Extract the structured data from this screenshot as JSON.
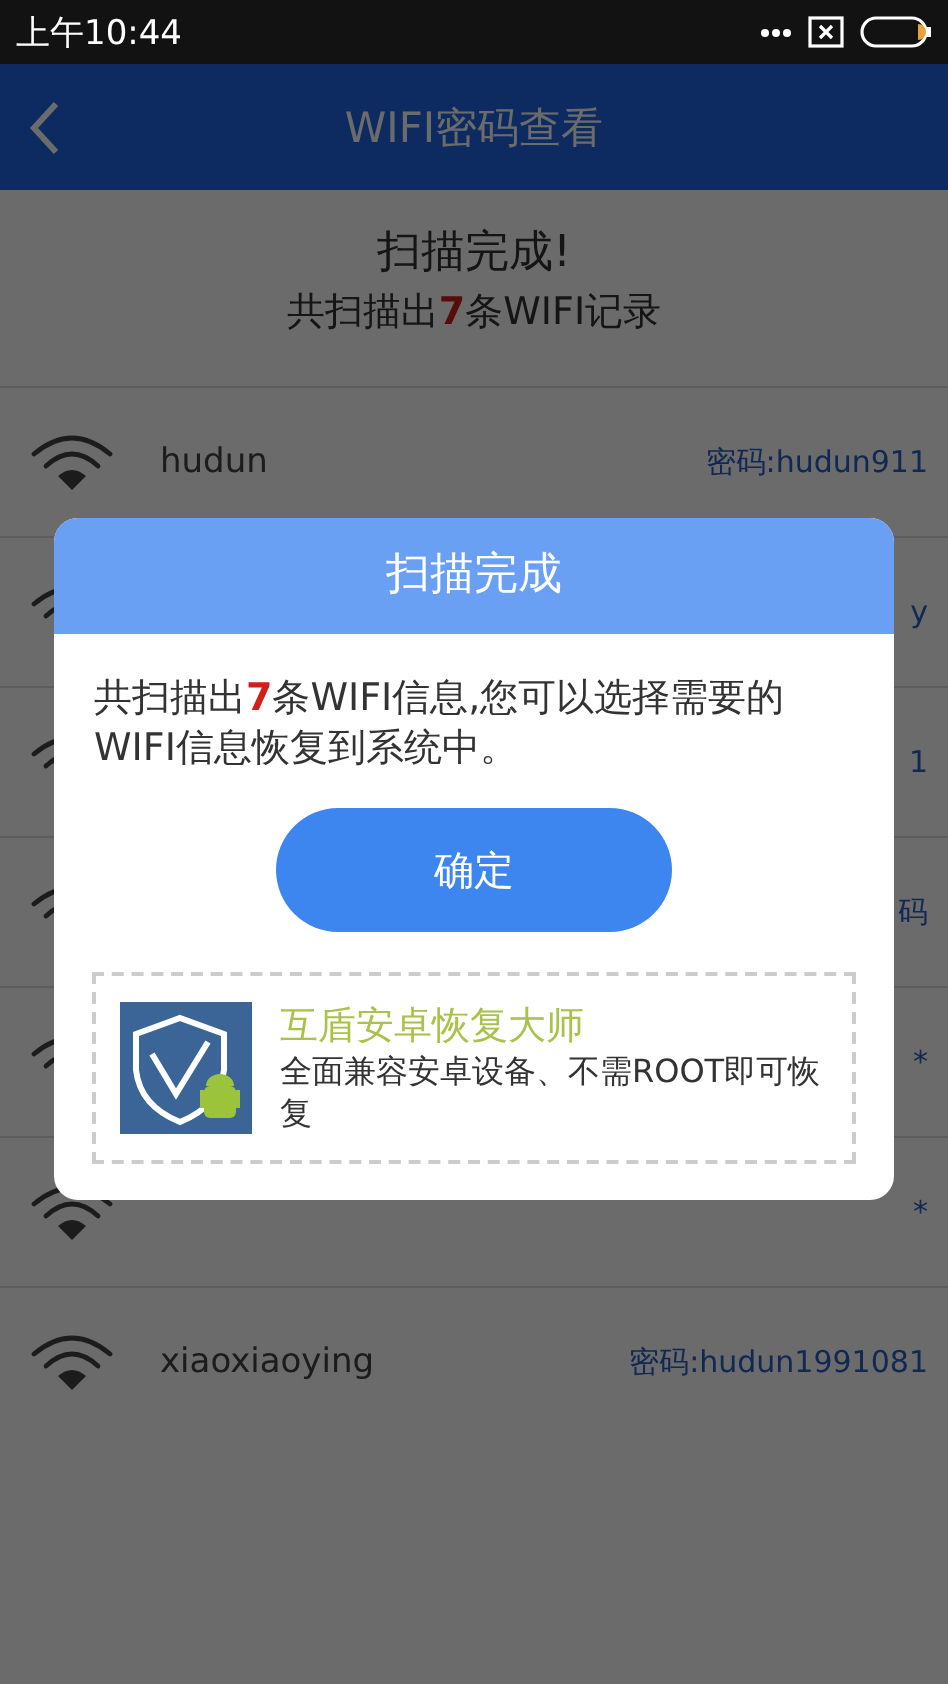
{
  "status_bar": {
    "time": "上午10:44"
  },
  "app_bar": {
    "title": "WIFI密码查看"
  },
  "summary": {
    "title": "扫描完成!",
    "detail": "共扫描出**7**条WIFI记录"
  },
  "networks": [
    {
      "name": "hudun",
      "password": "密码:hudun911"
    },
    {
      "password": "y"
    },
    {
      "password": "1"
    },
    {
      "password": "码"
    },
    {
      "password": "*"
    },
    {
      "password": "*"
    },
    {
      "name": "xiaoxiaoying",
      "password": "密码:hudun1991081"
    }
  ],
  "dialog": {
    "title": "扫描完成",
    "message": "共扫描出**7**条WIFI信息,您可以选择需要的WIFI信息恢复到系统中。",
    "button": "确定",
    "promo": {
      "title": "互盾安卓恢复大师",
      "description": "全面兼容安卓设备、不需ROOT即可恢复"
    }
  }
}
